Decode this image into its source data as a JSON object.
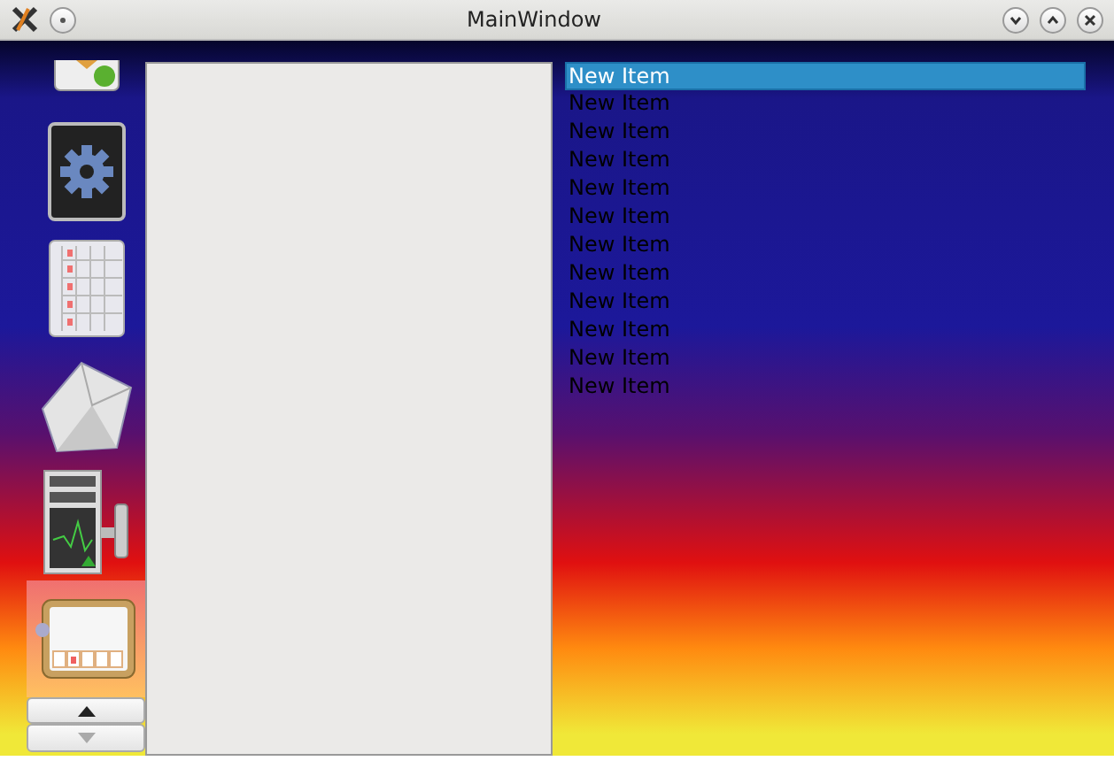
{
  "window": {
    "title": "MainWindow"
  },
  "toolbox": {
    "items": [
      {
        "selected": false
      },
      {
        "selected": false
      },
      {
        "selected": false
      },
      {
        "selected": false
      },
      {
        "selected": false
      },
      {
        "selected": true
      }
    ],
    "scroll_buttons": [
      {
        "disabled": false
      },
      {
        "disabled": true
      }
    ]
  },
  "list": {
    "items": [
      {
        "label": "New Item",
        "selected": true
      },
      {
        "label": "New Item",
        "selected": false
      },
      {
        "label": "New Item",
        "selected": false
      },
      {
        "label": "New Item",
        "selected": false
      },
      {
        "label": "New Item",
        "selected": false
      },
      {
        "label": "New Item",
        "selected": false
      },
      {
        "label": "New Item",
        "selected": false
      },
      {
        "label": "New Item",
        "selected": false
      },
      {
        "label": "New Item",
        "selected": false
      },
      {
        "label": "New Item",
        "selected": false
      },
      {
        "label": "New Item",
        "selected": false
      },
      {
        "label": "New Item",
        "selected": false
      }
    ]
  }
}
